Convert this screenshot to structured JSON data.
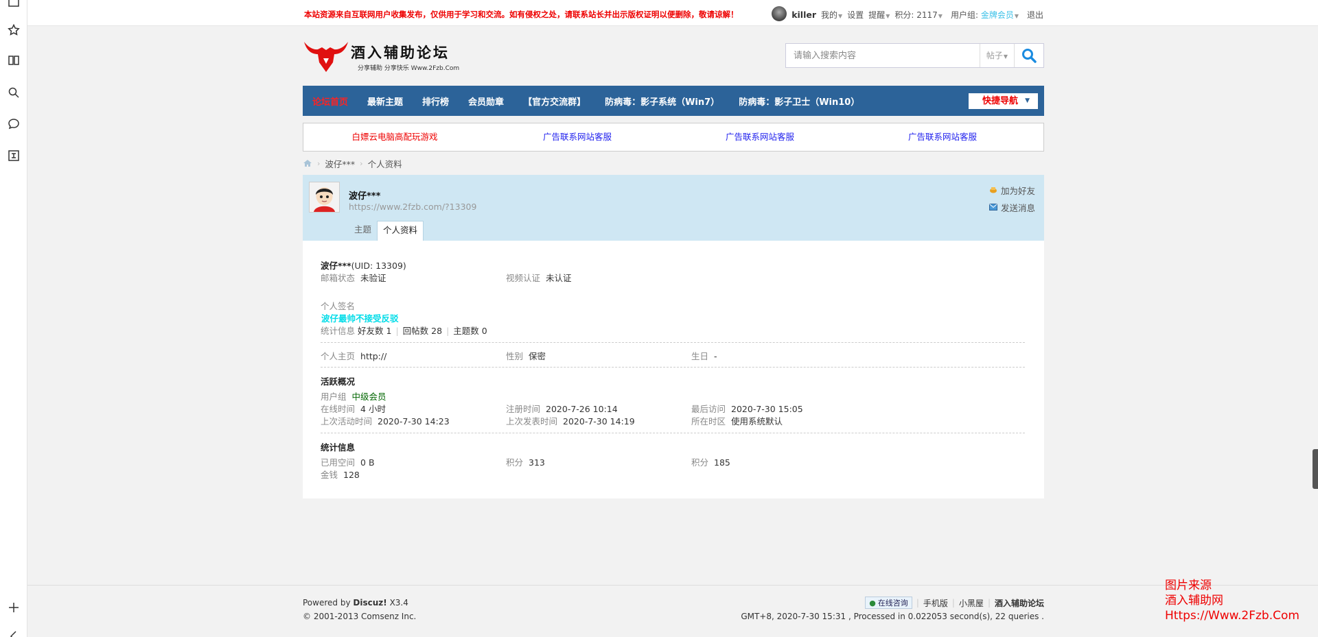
{
  "topbar": {
    "notice": "本站资源来自互联网用户收集发布，仅供用于学习和交流。如有侵权之处，请联系站长并出示版权证明以便删除，敬请谅解！",
    "username": "killer",
    "my": "我的",
    "settings": "设置",
    "remind": "提醒",
    "points": "积分: 2117",
    "usergroup_label": "用户组:",
    "usergroup_value": "金牌会员",
    "logout": "退出"
  },
  "header": {
    "logo_text": "酒入辅助论坛",
    "logo_sub": "分享辅助 分享快乐 Www.2Fzb.Com",
    "search_placeholder": "请输入搜索内容",
    "search_type": "帖子"
  },
  "nav": {
    "items": [
      "论坛首页",
      "最新主题",
      "排行榜",
      "会员勋章",
      "【官方交流群】",
      "防病毒：影子系统（Win7）",
      "防病毒：影子卫士（Win10）"
    ],
    "quick_nav": "快捷导航"
  },
  "ads": [
    "白嫖云电脑高配玩游戏",
    "广告联系网站客服",
    "广告联系网站客服",
    "广告联系网站客服"
  ],
  "breadcrumb": [
    "波仔***",
    "个人资料"
  ],
  "profile": {
    "name": "波仔***",
    "url": "https://www.2fzb.com/?13309",
    "tabs": [
      "主题",
      "个人资料"
    ],
    "add_friend": "加为好友",
    "send_message": "发送消息",
    "uid_line": "波仔***",
    "uid_suffix": "(UID: 13309)",
    "email_label": "邮箱状态",
    "email_value": "未验证",
    "video_label": "视频认证",
    "video_value": "未认证",
    "sig_label": "个人签名",
    "sig_value": "波仔最帅不接受反驳",
    "stats_label": "统计信息",
    "friends": "好友数 1",
    "replies": "回帖数 28",
    "threads": "主题数 0",
    "homepage_label": "个人主页",
    "homepage_value": "http://",
    "gender_label": "性别",
    "gender_value": "保密",
    "birthday_label": "生日",
    "birthday_value": "-",
    "activity_title": "活跃概况",
    "group_label": "用户组",
    "group_value": "中级会员",
    "online_label": "在线时间",
    "online_value": "4 小时",
    "reg_label": "注册时间",
    "reg_value": "2020-7-26 10:14",
    "last_visit_label": "最后访问",
    "last_visit_value": "2020-7-30 15:05",
    "last_active_label": "上次活动时间",
    "last_active_value": "2020-7-30 14:23",
    "last_post_label": "上次发表时间",
    "last_post_value": "2020-7-30 14:19",
    "tz_label": "所在时区",
    "tz_value": "使用系统默认",
    "stats_title": "统计信息",
    "space_label": "已用空间",
    "space_value": "0 B",
    "points1_label": "积分",
    "points1_value": "313",
    "points2_label": "积分",
    "points2_value": "185",
    "money_label": "金钱",
    "money_value": "128"
  },
  "footer": {
    "powered_by": "Powered by",
    "discuz": "Discuz!",
    "version": "X3.4",
    "copyright": "© 2001-2013 Comsenz Inc.",
    "consult": "在线咨询",
    "mobile": "手机版",
    "blackroom": "小黑屋",
    "site_name": "酒入辅助论坛",
    "gmt": "GMT+8, 2020-7-30 15:31 , Processed in 0.022053 second(s), 22 queries ."
  },
  "watermark": {
    "line1": "图片来源",
    "line2": "酒入辅助网",
    "line3": "Https://Www.2Fzb.Com"
  }
}
